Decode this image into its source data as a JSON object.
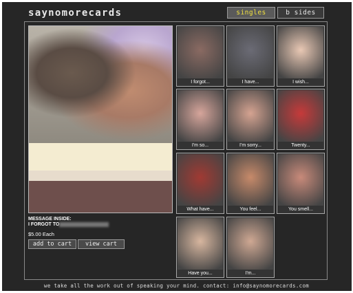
{
  "brand": {
    "logo_text": "saynomorecards"
  },
  "tabs": [
    {
      "label": "singles",
      "active": true
    },
    {
      "label": "b sides",
      "active": false
    }
  ],
  "product": {
    "message_title": "MESSAGE INSIDE:",
    "message_text": "I FORGOT TO",
    "price": "$5.00 Each",
    "add_to_cart": "add to cart",
    "view_cart": "view cart"
  },
  "thumbnails": [
    {
      "caption": "I forgot...",
      "bg": "#8a6a62"
    },
    {
      "caption": "I have...",
      "bg": "#6b6b75"
    },
    {
      "caption": "I wish...",
      "bg": "#e9c8b4"
    },
    {
      "caption": "I'm so...",
      "bg": "#d6a59b"
    },
    {
      "caption": "I'm sorry...",
      "bg": "#d5a391"
    },
    {
      "caption": "Twenty...",
      "bg": "#c63a3a"
    },
    {
      "caption": "What have...",
      "bg": "#a03a33"
    },
    {
      "caption": "You feel...",
      "bg": "#c78a6a"
    },
    {
      "caption": "You smell...",
      "bg": "#c88a7a"
    },
    {
      "caption": "Have you...",
      "bg": "#d7b69f"
    },
    {
      "caption": "I'm...",
      "bg": "#cfa893"
    }
  ],
  "footer": "we take all the work out of speaking your mind.   contact: info@saynomorecards.com",
  "colors": {
    "background": "#262626",
    "active_tab_text": "#f0e040"
  }
}
